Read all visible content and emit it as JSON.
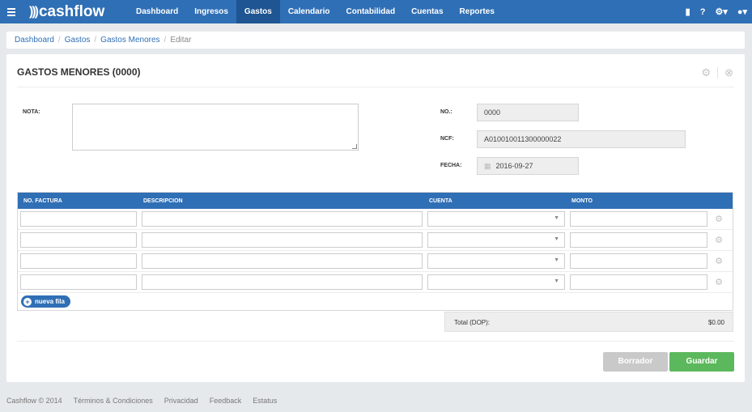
{
  "nav": {
    "brand": "cashflow",
    "items": [
      {
        "label": "Dashboard",
        "active": false
      },
      {
        "label": "Ingresos",
        "active": false
      },
      {
        "label": "Gastos",
        "active": true
      },
      {
        "label": "Calendario",
        "active": false
      },
      {
        "label": "Contabilidad",
        "active": false
      },
      {
        "label": "Cuentas",
        "active": false
      },
      {
        "label": "Reportes",
        "active": false
      }
    ],
    "right_icons": [
      "folder-icon",
      "help-icon",
      "settings-icon",
      "user-icon"
    ],
    "accent": "#2f6fb5"
  },
  "breadcrumb": {
    "items": [
      "Dashboard",
      "Gastos",
      "Gastos Menores"
    ],
    "current": "Editar"
  },
  "form": {
    "title": "GASTOS MENORES (0000)",
    "nota_label": "NOTA:",
    "nota_value": "",
    "no_label": "NO.:",
    "no_value": "0000",
    "ncf_label": "NCF:",
    "ncf_value": "A010010011300000022",
    "fecha_label": "FECHA:",
    "fecha_value": "2016-09-27"
  },
  "table": {
    "columns": [
      "NO. FACTURA",
      "DESCRIPCION",
      "CUENTA",
      "MONTO"
    ],
    "row_count": 4,
    "add_row_label": "nueva fila",
    "total_label": "Total (DOP):",
    "total_value": "$0.00"
  },
  "actions": {
    "draft_label": "Borrador",
    "save_label": "Guardar",
    "draft_color": "#c9c9c9",
    "save_color": "#5cb85c"
  },
  "footer": {
    "copyright": "Cashflow © 2014",
    "links": [
      "Términos & Condiciones",
      "Privacidad",
      "Feedback",
      "Estatus"
    ]
  }
}
